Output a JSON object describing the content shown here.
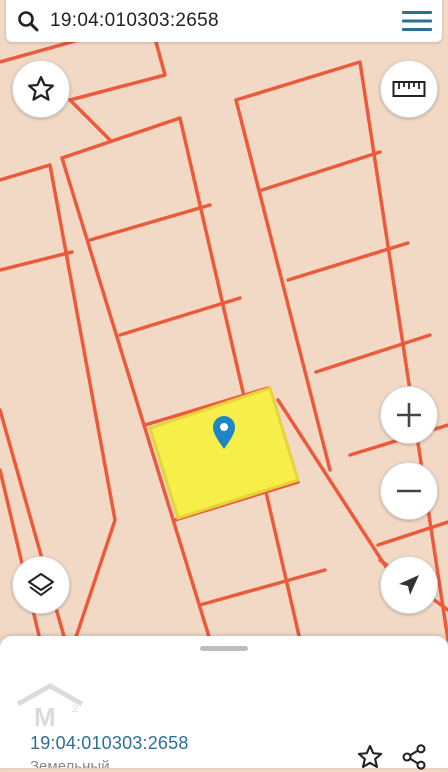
{
  "search": {
    "query": "19:04:010303:2658"
  },
  "map_controls": {
    "favorite": "star-icon",
    "measure": "ruler-icon",
    "zoom_in": "+",
    "zoom_out": "−",
    "layers": "layers-icon",
    "locate": "navigation-arrow-icon"
  },
  "info_panel": {
    "cadastral_number": "19:04:010303:2658",
    "subtitle": "Земельный"
  },
  "colors": {
    "map_background": "#f2d9c5",
    "parcel_outline": "#ec5a3c",
    "selected_parcel": "#f6ef4a",
    "marker": "#1e86c4",
    "accent": "#2b6f97"
  }
}
